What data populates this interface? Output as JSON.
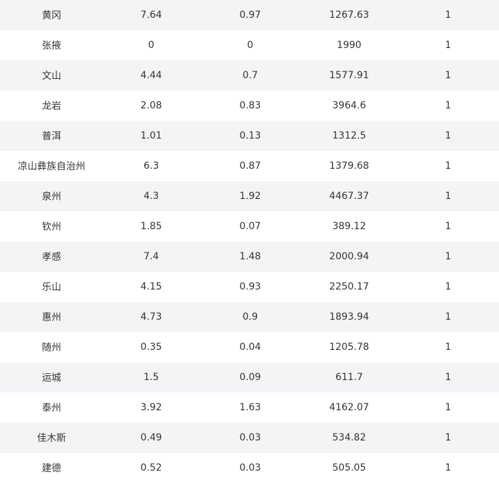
{
  "table": {
    "rows": [
      [
        "黄冈",
        "7.64",
        "0.97",
        "1267.63",
        "1"
      ],
      [
        "张掖",
        "0",
        "0",
        "1990",
        "1"
      ],
      [
        "文山",
        "4.44",
        "0.7",
        "1577.91",
        "1"
      ],
      [
        "龙岩",
        "2.08",
        "0.83",
        "3964.6",
        "1"
      ],
      [
        "普洱",
        "1.01",
        "0.13",
        "1312.5",
        "1"
      ],
      [
        "凉山彝族自治州",
        "6.3",
        "0.87",
        "1379.68",
        "1"
      ],
      [
        "泉州",
        "4.3",
        "1.92",
        "4467.37",
        "1"
      ],
      [
        "钦州",
        "1.85",
        "0.07",
        "389.12",
        "1"
      ],
      [
        "孝感",
        "7.4",
        "1.48",
        "2000.94",
        "1"
      ],
      [
        "乐山",
        "4.15",
        "0.93",
        "2250.17",
        "1"
      ],
      [
        "惠州",
        "4.73",
        "0.9",
        "1893.94",
        "1"
      ],
      [
        "随州",
        "0.35",
        "0.04",
        "1205.78",
        "1"
      ],
      [
        "运城",
        "1.5",
        "0.09",
        "611.7",
        "1"
      ],
      [
        "泰州",
        "3.92",
        "1.63",
        "4162.07",
        "1"
      ],
      [
        "佳木斯",
        "0.49",
        "0.03",
        "534.82",
        "1"
      ],
      [
        "建德",
        "0.52",
        "0.03",
        "505.05",
        "1"
      ]
    ]
  }
}
